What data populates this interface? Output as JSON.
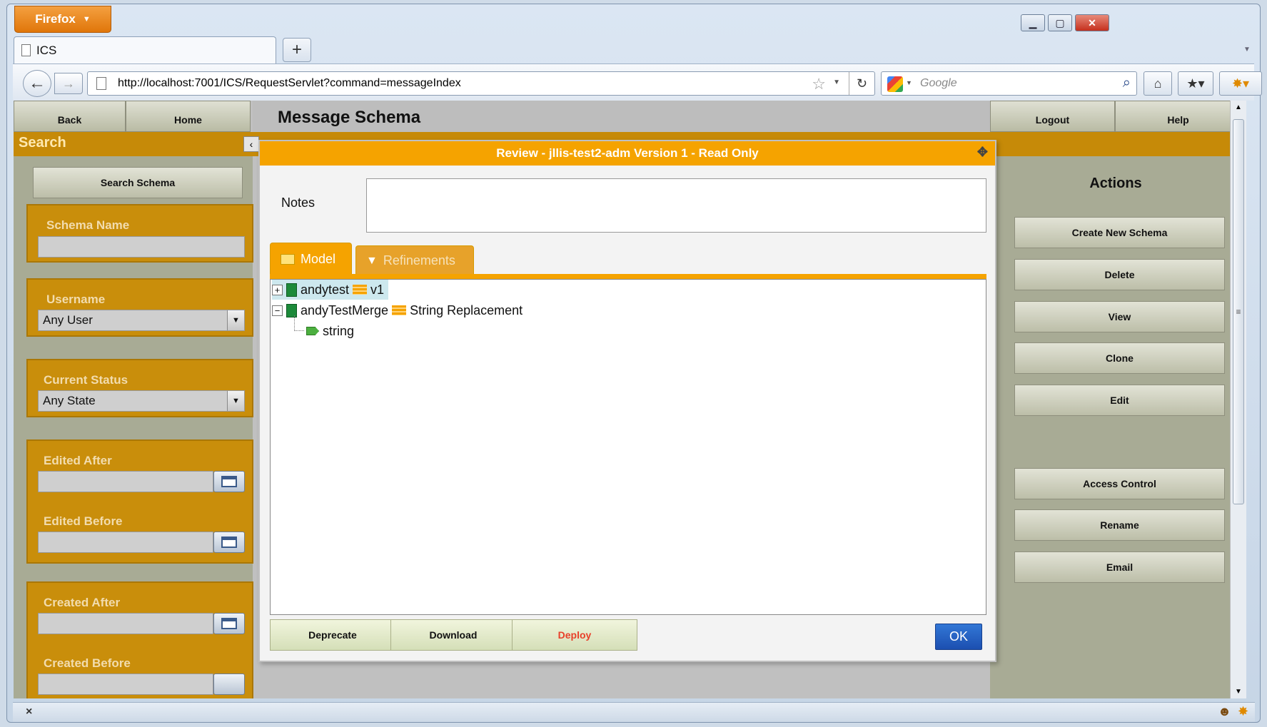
{
  "browser": {
    "menu_label": "Firefox",
    "tab_title": "ICS",
    "url": "http://localhost:7001/ICS/RequestServlet?command=messageIndex",
    "search_placeholder": "Google"
  },
  "app": {
    "nav": {
      "back": "Back",
      "home": "Home",
      "logout": "Logout",
      "help": "Help"
    },
    "page_title": "Message Schema",
    "search_panel": {
      "title": "Search",
      "search_button": "Search Schema",
      "schema_name_label": "Schema Name",
      "schema_name_value": "",
      "username_label": "Username",
      "username_value": "Any User",
      "status_label": "Current Status",
      "status_value": "Any State",
      "edited_after_label": "Edited After",
      "edited_before_label": "Edited Before",
      "created_after_label": "Created After",
      "created_before_label": "Created Before"
    },
    "actions": {
      "title": "Actions",
      "buttons": [
        "Create New Schema",
        "Delete",
        "View",
        "Clone",
        "Edit",
        "Access Control",
        "Rename",
        "Email"
      ]
    }
  },
  "dialog": {
    "title": "Review - jllis-test2-adm Version 1 - Read Only",
    "notes_label": "Notes",
    "notes_value": "",
    "tabs": [
      "Model",
      "Refinements"
    ],
    "active_tab": "Model",
    "tree": [
      {
        "name": "andytest",
        "tag": "v1",
        "expanded": false,
        "selected": true
      },
      {
        "name": "andyTestMerge",
        "tag": "String Replacement",
        "expanded": true,
        "children": [
          {
            "name": "string"
          }
        ]
      }
    ],
    "buttons": {
      "deprecate": "Deprecate",
      "download": "Download",
      "deploy": "Deploy",
      "ok": "OK"
    },
    "colors": {
      "header": "#f5a300",
      "deploy_text": "#e8402a",
      "ok": "#1c4fb0"
    }
  }
}
